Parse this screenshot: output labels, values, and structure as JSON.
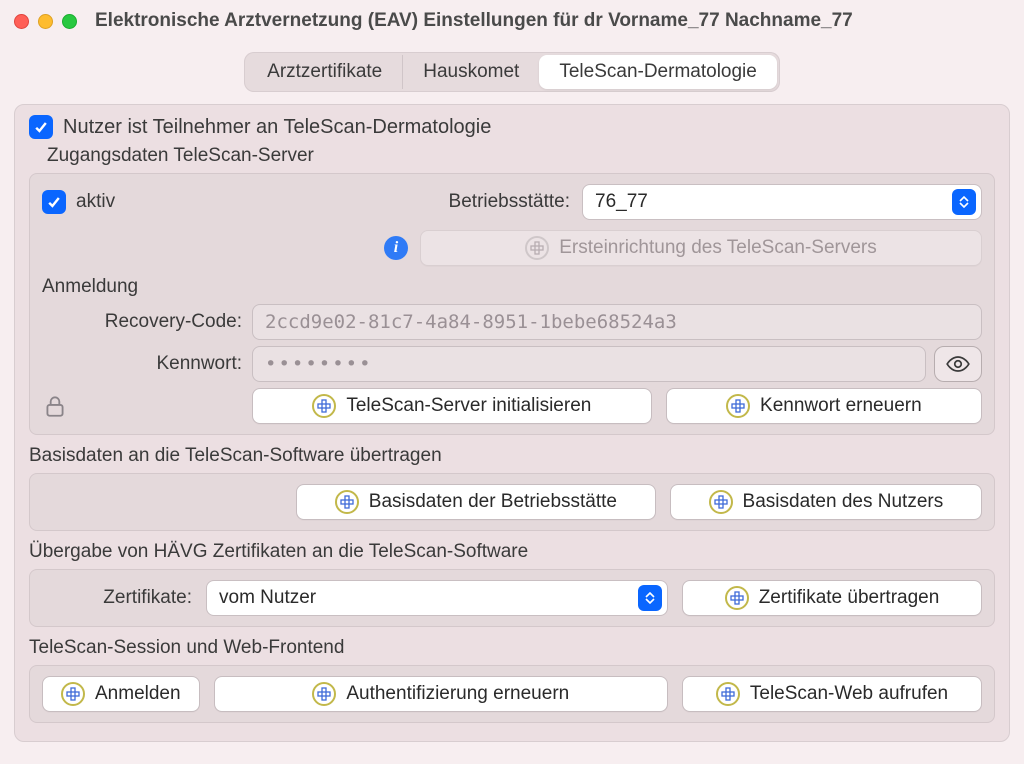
{
  "window": {
    "title": "Elektronische Arztvernetzung (EAV) Einstellungen für dr Vorname_77 Nachname_77"
  },
  "tabs": {
    "t0": "Arztzertifikate",
    "t1": "Hauskomet",
    "t2": "TeleScan-Dermatologie"
  },
  "participant": {
    "checkbox_label": "Nutzer ist Teilnehmer an TeleScan-Dermatologie"
  },
  "access": {
    "group_title": "Zugangsdaten TeleScan-Server",
    "active_label": "aktiv",
    "betriebsstaette_label": "Betriebsstätte:",
    "betriebsstaette_value": "76_77",
    "ersteinrichtung_label": "Ersteinrichtung des TeleScan-Servers",
    "anmeldung_label": "Anmeldung",
    "recovery_label": "Recovery-Code:",
    "recovery_value": "2ccd9e02-81c7-4a84-8951-1bebe68524a3",
    "kennwort_label": "Kennwort:",
    "kennwort_value": "••••••••",
    "btn_init": "TeleScan-Server initialisieren",
    "btn_renew_pw": "Kennwort erneuern"
  },
  "basisdaten": {
    "title": "Basisdaten an die TeleScan-Software übertragen",
    "btn_betrieb": "Basisdaten der Betriebsstätte",
    "btn_nutzer": "Basisdaten des Nutzers"
  },
  "haevg": {
    "title": "Übergabe von HÄVG Zertifikaten an die TeleScan-Software",
    "zert_label": "Zertifikate:",
    "zert_value": "vom Nutzer",
    "btn_transfer": "Zertifikate übertragen"
  },
  "session": {
    "title": "TeleScan-Session und Web-Frontend",
    "btn_login": "Anmelden",
    "btn_reauth": "Authentifizierung erneuern",
    "btn_web": "TeleScan-Web aufrufen"
  }
}
